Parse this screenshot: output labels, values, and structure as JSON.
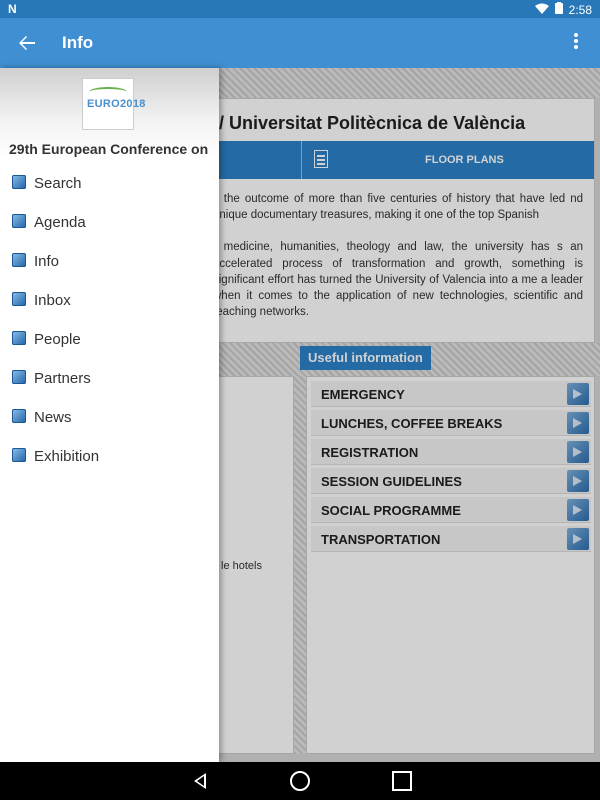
{
  "status_bar": {
    "notification_icon": "N",
    "time": "2:58",
    "battery_level_text": "+"
  },
  "app_bar": {
    "title": "Info",
    "back_icon": "arrow-left-icon",
    "menu_icon": "more-vert-icon"
  },
  "drawer": {
    "conference_name": "29th European Conference on",
    "logo_text": "EURO2018",
    "items": [
      {
        "label": "Search",
        "icon": "search-icon"
      },
      {
        "label": "Agenda",
        "icon": "agenda-icon"
      },
      {
        "label": "Info",
        "icon": "info-icon"
      },
      {
        "label": "Inbox",
        "icon": "inbox-icon"
      },
      {
        "label": "People",
        "icon": "people-icon"
      },
      {
        "label": "Partners",
        "icon": "partners-icon"
      },
      {
        "label": "News",
        "icon": "news-icon"
      },
      {
        "label": "Exhibition",
        "icon": "exhibition-icon"
      }
    ]
  },
  "venue": {
    "title": "/ Universitat Politècnica de València",
    "floor_plans_label": "FLOOR PLANS",
    "paragraph_1": "s the outcome of more than five centuries of history that have led nd unique documentary treasures, making it one of the top Spanish",
    "paragraph_2": "f medicine, humanities, theology and law, the university has s an accelerated process of transformation and growth, something is significant effort has turned the University of Valencia into a me a leader when it comes to the application of new technologies, scientific and teaching networks."
  },
  "useful_info": {
    "header": "Useful information",
    "items": [
      "EMERGENCY",
      "LUNCHES, COFFEE BREAKS",
      "REGISTRATION",
      "SESSION GUIDELINES",
      "SOCIAL PROGRAMME",
      "TRANSPORTATION"
    ]
  },
  "left_panel": {
    "hotels_text": "le hotels"
  }
}
